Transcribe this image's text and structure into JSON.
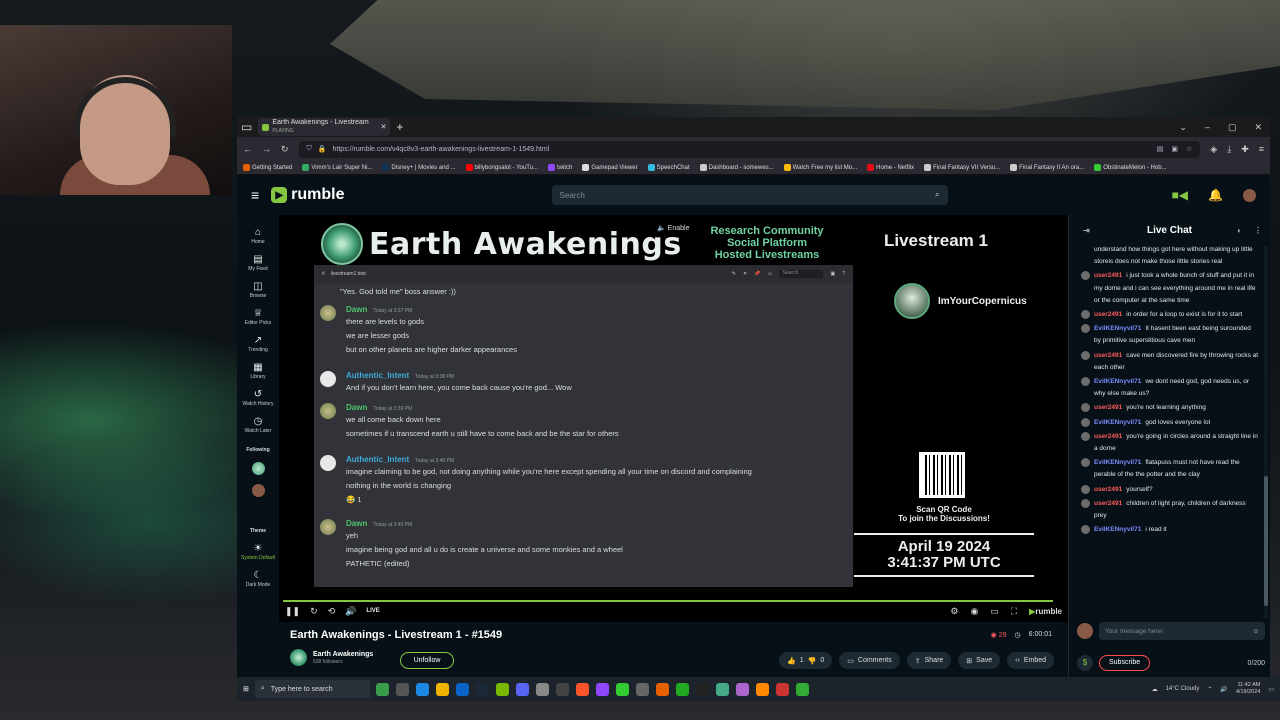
{
  "browser": {
    "tab_title": "Earth Awakenings - Livestream",
    "tab_status": "PLAYING",
    "url": "https://rumble.com/v4qc8v3-earth-awakenings-livestream-1-1549.html"
  },
  "bookmarks": [
    {
      "label": "Getting Started",
      "color": "#e66000"
    },
    {
      "label": "Vimm's Lair Super Ni...",
      "color": "#3a6"
    },
    {
      "label": "Disney+ | Movies and ...",
      "color": "#135"
    },
    {
      "label": "billybongsalot - YouTu...",
      "color": "#f00"
    },
    {
      "label": "twitch",
      "color": "#9146ff"
    },
    {
      "label": "Gamepad Viewer",
      "color": "#ddd"
    },
    {
      "label": "SpeechChat",
      "color": "#3bd"
    },
    {
      "label": "Dashboard - somewes...",
      "color": "#ccc"
    },
    {
      "label": "Watch Free my list Mo...",
      "color": "#fb0"
    },
    {
      "label": "Home - Netflix",
      "color": "#e50914"
    },
    {
      "label": "Final Fantasy VII Versu...",
      "color": "#ccc"
    },
    {
      "label": "Final Fantasy II An ora...",
      "color": "#ccc"
    },
    {
      "label": "ObstinateMelon - Hob...",
      "color": "#3c3"
    }
  ],
  "header": {
    "logo": "rumble",
    "search_placeholder": "Search"
  },
  "sidebar": {
    "items": [
      {
        "label": "Home",
        "icon": "⌂"
      },
      {
        "label": "My Feed",
        "icon": "▤"
      },
      {
        "label": "Browse",
        "icon": "◫"
      },
      {
        "label": "Editor Picks",
        "icon": "♕"
      },
      {
        "label": "Trending",
        "icon": "↗"
      },
      {
        "label": "Library",
        "icon": "▦"
      },
      {
        "label": "Watch History",
        "icon": "↺"
      },
      {
        "label": "Watch Later",
        "icon": "◷"
      }
    ],
    "following": "Following",
    "theme": "Theme",
    "system_default": "System Default",
    "dark_mode": "Dark Mode"
  },
  "stream": {
    "title": "Earth Awakenings",
    "enable": "Enable",
    "rcs": [
      "Research Community",
      "Social Platform",
      "Hosted Livestreams"
    ],
    "livestream": "Livestream 1",
    "user": "ImYourCopernicus",
    "qr_caption": [
      "Scan QR Code",
      "To join the Discussions!"
    ],
    "date": "April 19 2024",
    "time": "3:41:37 PM UTC",
    "channel_top": "livestream1 test",
    "live": "LIVE",
    "discord": {
      "first_line": "\"Yes. God told me\" boss answer :))",
      "messages": [
        {
          "name": "Dawn",
          "color": "#4ec46b",
          "time": "Today at 3:37 PM",
          "lines": [
            "there are levels to gods",
            "we are lesser gods",
            "but on other planets are higher darker appearances"
          ]
        },
        {
          "name": "Authentic_Intent",
          "color": "#3fa9d8",
          "time": "Today at 3:38 PM",
          "lines": [
            "And if you don't learn here, you come back cause you're god... Wow"
          ]
        },
        {
          "name": "Dawn",
          "color": "#4ec46b",
          "time": "Today at 3:39 PM",
          "lines": [
            "we all come back down here",
            "sometimes if u transcend earth u still have to come back and be the star for others"
          ]
        },
        {
          "name": "Authentic_Intent",
          "color": "#3fa9d8",
          "time": "Today at 3:40 PM",
          "lines": [
            "imagine claiming to be god, not doing anything while you're here except spending all your time on discord and complaining",
            "nothing in the world is changing",
            "😂 1"
          ]
        },
        {
          "name": "Dawn",
          "color": "#4ec46b",
          "time": "Today at 3:40 PM",
          "lines": [
            "yeh",
            "imagine being god and all u do is create a universe and some monkies and a wheel",
            "PATHETIC (edited)"
          ]
        }
      ]
    }
  },
  "video_info": {
    "name": "Earth Awakenings - Livestream 1 - #1549",
    "viewers": "29",
    "duration": "6:00:01",
    "channel": "Earth Awakenings",
    "followers": "638 followers",
    "unfollow": "Unfollow",
    "likes": "1",
    "dislikes": "0",
    "comments": "Comments",
    "share": "Share",
    "save": "Save",
    "embed": "Embed"
  },
  "chat": {
    "title": "Live Chat",
    "placeholder": "Your message here!",
    "subscribe": "Subscribe",
    "count": "0/200",
    "messages": [
      {
        "user": "",
        "color": "#ff5c5c",
        "text": "understand how things got here without making up little storeis does not make those little stories real"
      },
      {
        "user": "user2491",
        "color": "#ff5c5c",
        "text": "i just took a whole bunch of stuff and put it in my dome and i can see everything around me in real life or the computer at the same time"
      },
      {
        "user": "user2491",
        "color": "#ff5c5c",
        "text": "in order for a loop to exist is for it to start"
      },
      {
        "user": "EvilKENnyvil71",
        "color": "#7a8cff",
        "text": "It hasent been east being surounded by primitive superstitious cave men"
      },
      {
        "user": "user2491",
        "color": "#ff5c5c",
        "text": "cave men discovered fire by throwing rocks at each other"
      },
      {
        "user": "EvilKENnyvil71",
        "color": "#7a8cff",
        "text": "we dont need god, god needs us, or why else make us?"
      },
      {
        "user": "user2491",
        "color": "#ff5c5c",
        "text": "you're not learning anything"
      },
      {
        "user": "EvilKENnyvil71",
        "color": "#7a8cff",
        "text": "god loves everyone lol"
      },
      {
        "user": "user2491",
        "color": "#ff5c5c",
        "text": "you're going in circles around a straight line in a dome"
      },
      {
        "user": "EvilKENnyvil71",
        "color": "#7a8cff",
        "text": "flatapuss must not have read the perable of the the potter and the clay"
      },
      {
        "user": "user2491",
        "color": "#ff5c5c",
        "text": "yourself?"
      },
      {
        "user": "user2491",
        "color": "#ff5c5c",
        "text": "children of light pray, children of darkness prey"
      },
      {
        "user": "EvilKENnyvil71",
        "color": "#7a8cff",
        "text": "i read it"
      }
    ]
  },
  "taskbar": {
    "search": "Type here to search",
    "weather": "14°C Cloudy",
    "time": "11:42 AM",
    "date": "4/19/2024"
  }
}
